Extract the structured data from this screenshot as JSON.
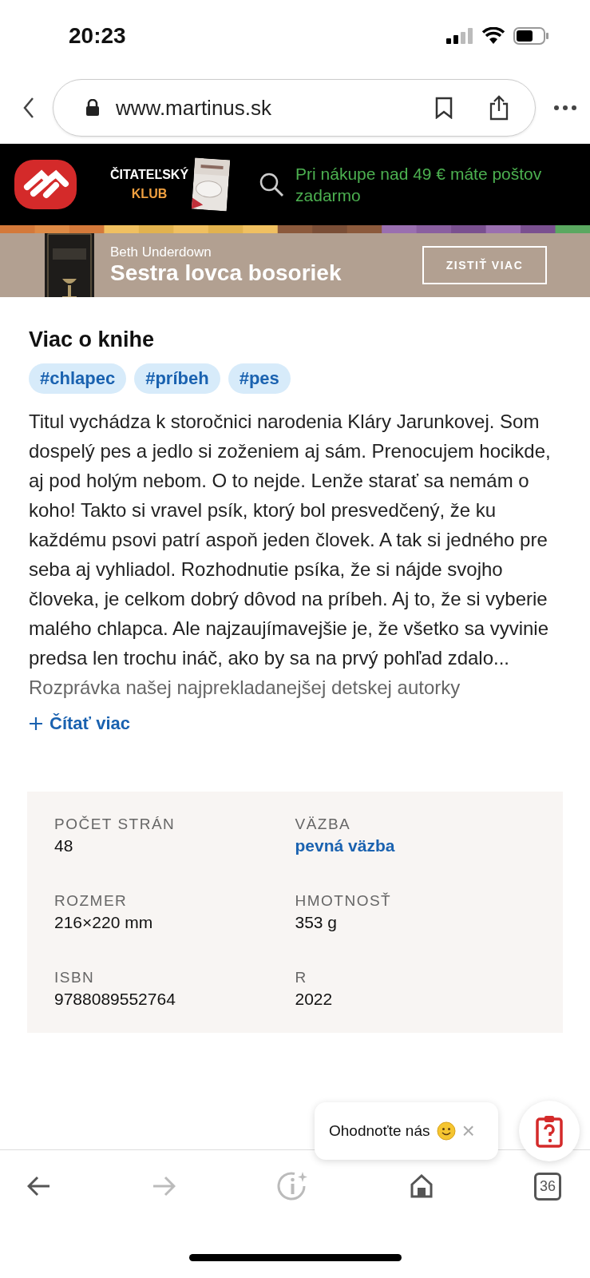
{
  "status_bar": {
    "time": "20:23"
  },
  "browser": {
    "url": "www.martinus.sk",
    "tab_count": "36",
    "forward_disabled": true
  },
  "header": {
    "club_line1": "ČITATEĽSKÝ",
    "club_line2": "KLUB",
    "promo_line1": "Pri nákupe nad 49 € máte poštov",
    "promo_line2": "zadarmo"
  },
  "banner": {
    "author": "Beth Underdown",
    "title": "Sestra lovca bosoriek",
    "button": "ZISTIŤ VIAC"
  },
  "about": {
    "heading": "Viac o knihe",
    "tags": [
      "#chlapec",
      "#príbeh",
      "#pes"
    ],
    "description": "Titul vychádza k storočnici narodenia Kláry Jarunkovej. Som dospelý pes a jedlo si zoženiem aj sám. Prenocujem hocikde, aj pod holým nebom. O to nejde. Lenže starať sa nemám o koho! Takto si vravel psík, ktorý bol presvedčený, že ku každému psovi patrí aspoň jeden človek. A tak si jedného pre seba aj vyhliadol. Rozhodnutie psíka, že si nájde svojho človeka, je celkom dobrý dôvod na príbeh. Aj to, že si vyberie malého chlapca. Ale najzaujímavejšie je, že všetko sa vyvinie predsa len trochu ináč, ako by sa na prvý pohľad zdalo...",
    "faded_line": "Rozprávka našej najprekladanejšej detskej autorky",
    "read_more": "Čítať viac"
  },
  "details": [
    {
      "label": "POČET STRÁN",
      "value": "48",
      "kind": "text"
    },
    {
      "label": "VÄZBA",
      "value": "pevná väzba",
      "kind": "link"
    },
    {
      "label": "ROZMER",
      "value": "216×220 mm",
      "kind": "text"
    },
    {
      "label": "HMOTNOSŤ",
      "value": "353 g",
      "kind": "text"
    },
    {
      "label": "ISBN",
      "value": "9788089552764",
      "kind": "text"
    },
    {
      "label": "R",
      "value": "2022",
      "kind": "text"
    }
  ],
  "rating_popup": {
    "text": "Ohodnoťte nás",
    "close": "×"
  }
}
